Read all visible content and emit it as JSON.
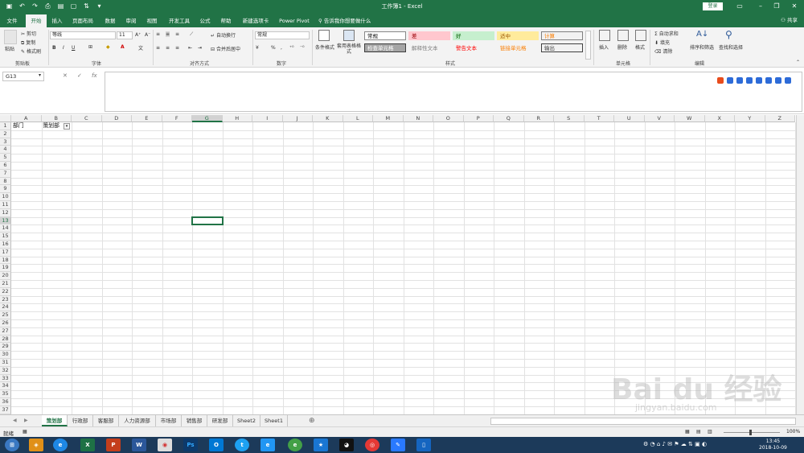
{
  "window": {
    "title": "工作簿1 - Excel",
    "signin": "登录",
    "share": "共享"
  },
  "tabs": [
    "文件",
    "开始",
    "插入",
    "页面布局",
    "数据",
    "审阅",
    "视图",
    "开发工具",
    "公式",
    "帮助",
    "新建选项卡",
    "Power Pivot"
  ],
  "tell_me": "告诉我你想要做什么",
  "ribbon": {
    "clipboard": {
      "paste": "粘贴",
      "cut": "剪切",
      "copy": "复制",
      "format_painter": "格式刷",
      "label": "剪贴板"
    },
    "font": {
      "name": "等线",
      "size": "11",
      "label": "字体"
    },
    "alignment": {
      "wrap": "自动换行",
      "merge": "合并后居中",
      "label": "对齐方式"
    },
    "number": {
      "format": "常规",
      "label": "数字"
    },
    "styles": {
      "conditional": "条件格式",
      "table": "套用表格格式",
      "label": "样式",
      "cells": [
        {
          "text": "常规",
          "bg": "#ffffff",
          "color": "#000000",
          "border": "#888888"
        },
        {
          "text": "差",
          "bg": "#ffc7ce",
          "color": "#9c0006",
          "border": "#ffc7ce"
        },
        {
          "text": "好",
          "bg": "#c6efce",
          "color": "#006100",
          "border": "#c6efce"
        },
        {
          "text": "适中",
          "bg": "#ffeb9c",
          "color": "#9c5700",
          "border": "#ffeb9c"
        },
        {
          "text": "计算",
          "bg": "#f2f2f2",
          "color": "#fa7d00",
          "border": "#7f7f7f"
        },
        {
          "text": "检查单元格",
          "bg": "#a5a5a5",
          "color": "#ffffff",
          "border": "#3f3f3f"
        },
        {
          "text": "解释性文本",
          "bg": "#f3f3f3",
          "color": "#7f7f7f",
          "border": "#f3f3f3"
        },
        {
          "text": "警告文本",
          "bg": "#f3f3f3",
          "color": "#ff0000",
          "border": "#f3f3f3"
        },
        {
          "text": "链接单元格",
          "bg": "#f3f3f3",
          "color": "#fa7d00",
          "border": "#f3f3f3"
        },
        {
          "text": "输出",
          "bg": "#f2f2f2",
          "color": "#3f3f3f",
          "border": "#3f3f3f"
        }
      ]
    },
    "cells_group": {
      "insert": "插入",
      "delete": "删除",
      "format": "格式",
      "label": "单元格"
    },
    "editing": {
      "autosum": "自动求和",
      "fill": "填充",
      "clear": "清除",
      "sort": "排序和筛选",
      "find": "查找和选择",
      "label": "编辑"
    }
  },
  "formula_bar": {
    "name_box": "G13",
    "fx": "fx",
    "content": ""
  },
  "grid": {
    "columns": [
      "A",
      "B",
      "C",
      "D",
      "E",
      "F",
      "G",
      "H",
      "I",
      "J",
      "K",
      "L",
      "M",
      "N",
      "O",
      "P",
      "Q",
      "R",
      "S",
      "T",
      "U",
      "V",
      "W",
      "X",
      "Y",
      "Z"
    ],
    "row_count": 37,
    "selected_column": "G",
    "selected_row": 13,
    "cells": [
      {
        "ref": "A1",
        "text": "部门"
      },
      {
        "ref": "B1",
        "text": "策划部"
      }
    ]
  },
  "sheets": [
    "策划部",
    "行政部",
    "客服部",
    "人力资源部",
    "市场部",
    "销售部",
    "研发部",
    "Sheet2",
    "Sheet1"
  ],
  "active_sheet": "策划部",
  "status": {
    "ready": "就绪",
    "zoom": "100%"
  },
  "taskbar": {
    "time": "13:45",
    "date": "2018-10-09"
  },
  "watermark": {
    "main": "Bai du 经验",
    "sub": "jingyan.baidu.com"
  }
}
